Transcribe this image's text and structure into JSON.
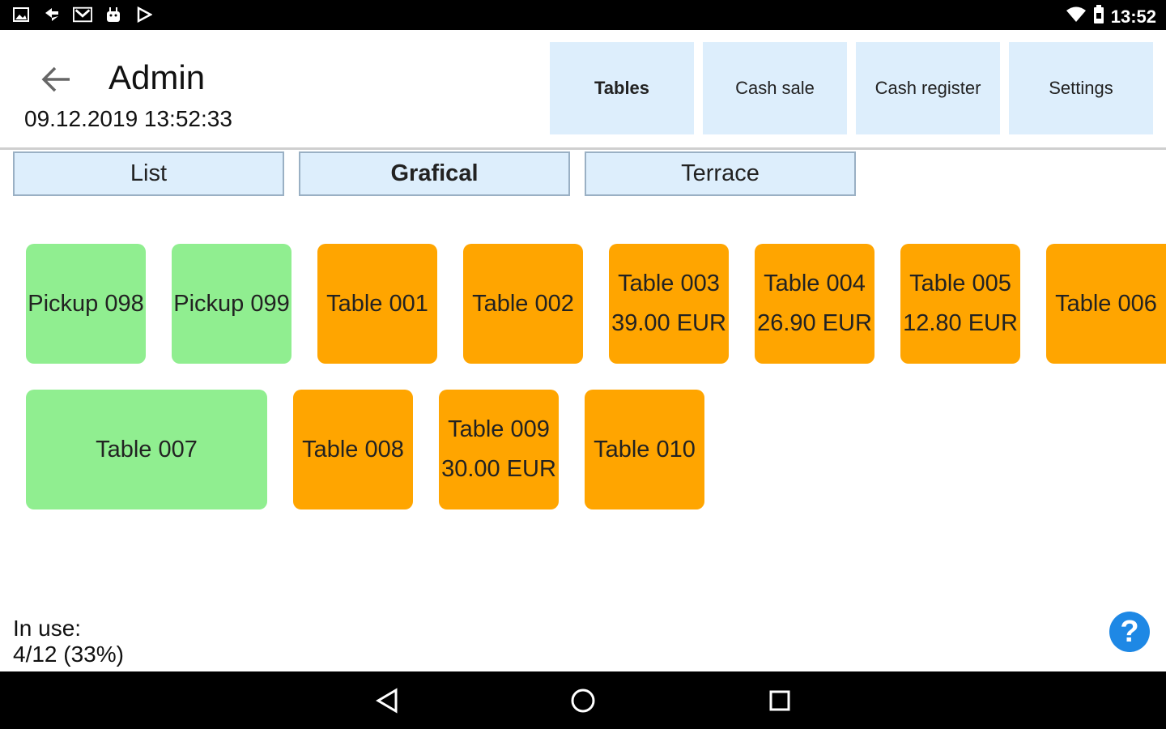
{
  "status_bar": {
    "time": "13:52",
    "icons": [
      "image-icon",
      "sync-icon",
      "gmail-icon",
      "android-icon",
      "play-store-icon"
    ],
    "right_icons": [
      "wifi-icon",
      "battery-icon"
    ]
  },
  "header": {
    "title": "Admin",
    "datetime": "09.12.2019 13:52:33",
    "nav": [
      {
        "label": "Tables",
        "active": true
      },
      {
        "label": "Cash sale",
        "active": false
      },
      {
        "label": "Cash register",
        "active": false
      },
      {
        "label": "Settings",
        "active": false
      }
    ]
  },
  "tabs": [
    {
      "label": "List",
      "active": false
    },
    {
      "label": "Grafical",
      "active": true
    },
    {
      "label": "Terrace",
      "active": false
    }
  ],
  "tables": [
    {
      "name": "Pickup 098",
      "amount": "",
      "status": "free"
    },
    {
      "name": "Pickup 099",
      "amount": "",
      "status": "free"
    },
    {
      "name": "Table 001",
      "amount": "",
      "status": "occupied"
    },
    {
      "name": "Table 002",
      "amount": "",
      "status": "occupied"
    },
    {
      "name": "Table 003",
      "amount": "39.00 EUR",
      "status": "occupied"
    },
    {
      "name": "Table 004",
      "amount": "26.90 EUR",
      "status": "occupied"
    },
    {
      "name": "Table 005",
      "amount": "12.80 EUR",
      "status": "occupied"
    },
    {
      "name": "Table 006",
      "amount": "",
      "status": "occupied"
    },
    {
      "name": "Table 007",
      "amount": "",
      "status": "free"
    },
    {
      "name": "Table 008",
      "amount": "",
      "status": "occupied"
    },
    {
      "name": "Table 009",
      "amount": "30.00 EUR",
      "status": "occupied"
    },
    {
      "name": "Table 010",
      "amount": "",
      "status": "occupied"
    }
  ],
  "footer": {
    "in_use_label": "In use:",
    "in_use_value": "4/12 (33%)",
    "help_symbol": "?"
  },
  "colors": {
    "free": "#90ee90",
    "occupied": "#ffa500",
    "button_bg": "#ddeefc",
    "help": "#1e88e5"
  }
}
